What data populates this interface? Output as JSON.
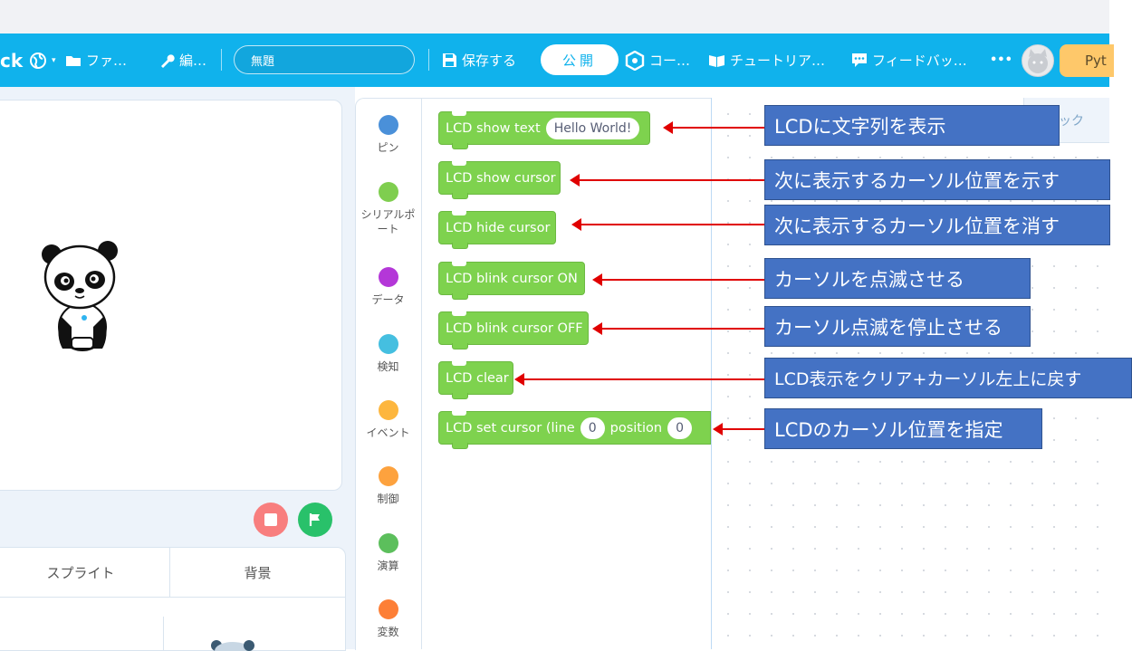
{
  "header": {
    "brand_fragment": "ck",
    "file_menu": "ファ…",
    "edit_menu": "編…",
    "project_name": "無題",
    "save_label": "保存する",
    "publish_label": "公開",
    "code_label": "コー…",
    "tutorial_label": "チュートリア…",
    "feedback_label": "フィードバッ…",
    "more_label": "•••",
    "python_label": "Pyt"
  },
  "stage_tabs": {
    "sprite_tab": "スプライト",
    "backdrop_tab": "背景"
  },
  "categories": [
    {
      "label": "ピン",
      "color": "#4a90d9"
    },
    {
      "label": "シリアルポート",
      "color": "#7fce4f"
    },
    {
      "label": "データ",
      "color": "#b437d8"
    },
    {
      "label": "検知",
      "color": "#45bfe0"
    },
    {
      "label": "イベント",
      "color": "#fdb63e"
    },
    {
      "label": "制御",
      "color": "#fda23e"
    },
    {
      "label": "演算",
      "color": "#5cbf5c"
    },
    {
      "label": "変数",
      "color": "#fd7f36"
    }
  ],
  "workspace_tab": "ブロック",
  "blocks": {
    "b1_text": "LCD show text",
    "b1_input": "Hello World!",
    "b2_text": "LCD show cursor",
    "b3_text": "LCD hide cursor",
    "b4_text": "LCD blink cursor ON",
    "b5_text": "LCD blink cursor OFF",
    "b6_text": "LCD clear",
    "b7_text": "LCD set cursor (line",
    "b7_line": "0",
    "b7_pos_label": "position",
    "b7_pos": "0"
  },
  "callouts": {
    "c1": "LCDに文字列を表示",
    "c2": "次に表示するカーソル位置を示す",
    "c3": "次に表示するカーソル位置を消す",
    "c4": "カーソルを点滅させる",
    "c5": "カーソル点滅を停止させる",
    "c6": "LCD表示をクリア+カーソル左上に戻す",
    "c7": "LCDのカーソル位置を指定"
  },
  "colors": {
    "header": "#10b2ec",
    "block_green": "#7ed24e",
    "callout_blue": "#4472c4",
    "arrow_red": "#e00000"
  }
}
